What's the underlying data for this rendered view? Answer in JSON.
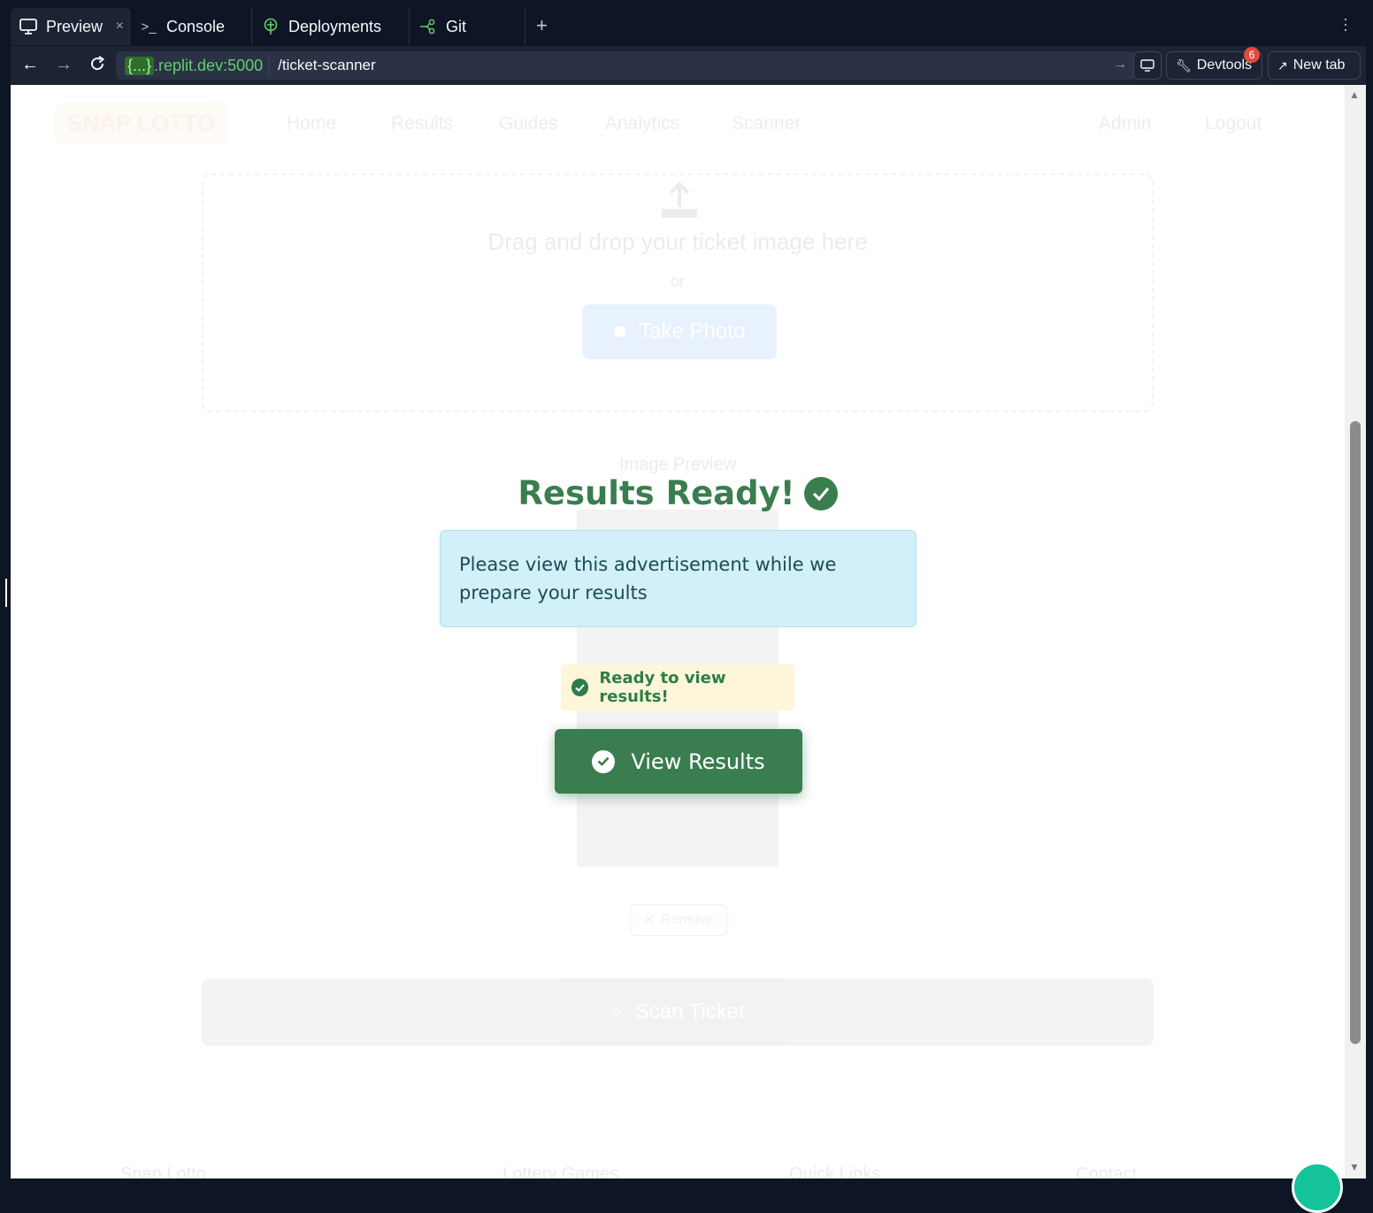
{
  "tabs": [
    {
      "label": "Preview",
      "icon": "monitor-icon",
      "active": true
    },
    {
      "label": "Console",
      "icon": "terminal-icon"
    },
    {
      "label": "Deployments",
      "icon": "deploy-icon"
    },
    {
      "label": "Git",
      "icon": "git-icon"
    }
  ],
  "url": {
    "host_prefix": "{...}",
    "host": ".replit.dev:5000",
    "path": "/ticket-scanner"
  },
  "toolbar": {
    "devtools_label": "Devtools",
    "devtools_badge": "6",
    "newtab_label": "New tab"
  },
  "background_page": {
    "brand": "SNAP LOTTO",
    "nav": [
      "Home",
      "Results",
      "Guides",
      "Analytics",
      "Scanner"
    ],
    "nav_right": [
      "Admin",
      "Logout"
    ],
    "drop_title": "Drag and drop your ticket image here",
    "or_text": "or",
    "take_photo": "Take Photo",
    "preview_label": "Image Preview",
    "remove_label": "Remove",
    "scan_label": "Scan Ticket",
    "footer": [
      "Snap Lotto",
      "Lottery Games",
      "Quick Links",
      "Contact"
    ]
  },
  "modal": {
    "title": "Results Ready!",
    "ad_text": "Please view this advertisement while we prepare your results",
    "ready_text": "Ready to view results!",
    "button_label": "View Results"
  },
  "colors": {
    "accent_green": "#3a7d4f",
    "ad_bg": "#d1f0f8",
    "ready_bg": "#fdf6d8"
  }
}
